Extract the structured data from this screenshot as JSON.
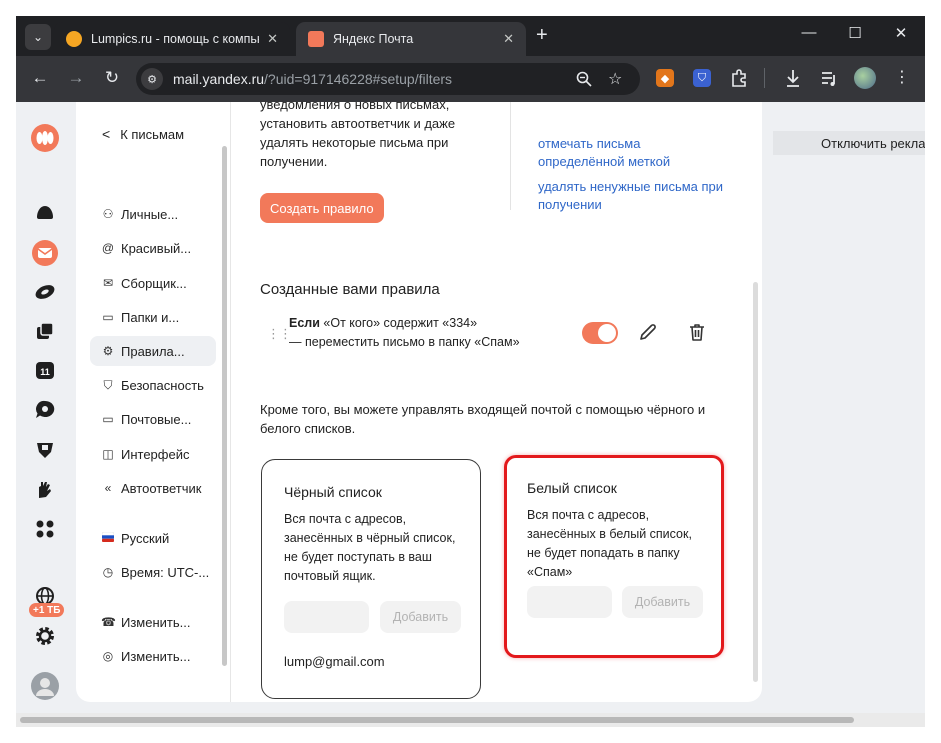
{
  "browser": {
    "tabs": [
      {
        "title": "Lumpics.ru - помощь с компьютером",
        "favicon_color": "#f5a623",
        "active": false
      },
      {
        "title": "Яндекс Почта",
        "favicon_color": "#f2795a",
        "active": true
      }
    ],
    "new_tab_symbol": "+",
    "window_controls": {
      "minimize": "—",
      "maximize": "☐",
      "close": "✕"
    },
    "nav": {
      "back": "←",
      "forward": "→",
      "reload": "↻"
    },
    "url_host": "mail.yandex.ru",
    "url_path": "/?uid=917146228#setup/filters",
    "icons": [
      "zoom-icon",
      "star-icon",
      "fox-extension-icon",
      "shield-extension-icon",
      "puzzle-icon",
      "download-icon",
      "playlist-icon",
      "profile-avatar",
      "menu-icon"
    ]
  },
  "settings_nav": {
    "back_label": "К письмам",
    "items": [
      {
        "label": "Личные...",
        "icon": "person"
      },
      {
        "label": "Красивый...",
        "icon": "at"
      },
      {
        "label": "Сборщик...",
        "icon": "envelope"
      },
      {
        "label": "Папки и...",
        "icon": "folder"
      },
      {
        "label": "Правила...",
        "icon": "rules",
        "active": true
      },
      {
        "label": "Безопасность",
        "icon": "shield"
      },
      {
        "label": "Почтовые...",
        "icon": "laptop"
      },
      {
        "label": "Интерфейс",
        "icon": "layout"
      },
      {
        "label": "Автоответчик",
        "icon": "reply"
      },
      {
        "label": "Русский",
        "icon": "ru-flag"
      },
      {
        "label": "Время: UTC-...",
        "icon": "clock"
      },
      {
        "label": "Изменить...",
        "icon": "phone"
      },
      {
        "label": "Изменить...",
        "icon": "id"
      }
    ]
  },
  "rail": {
    "storage_badge": "+1 ТБ"
  },
  "content": {
    "intro_lines": [
      "уведомления о новых письмах,",
      "установить автоответчик и даже",
      "удалять некоторые письма при",
      "получении."
    ],
    "side_links": [
      {
        "line1": "отмечать письма",
        "line2": "определённой меткой"
      },
      {
        "line1": "удалять ненужные письма при",
        "line2": "получении"
      }
    ],
    "create_rule_button": "Создать правило",
    "rules_title": "Созданные вами правила",
    "rule": {
      "if_word": "Если",
      "condition": " «От кого» содержит «334»",
      "action": "— переместить письмо в папку «Спам»",
      "enabled": true
    },
    "lists_intro_line1": "Кроме того, вы можете управлять входящей почтой с помощью чёрного и",
    "lists_intro_line2": "белого списков.",
    "blacklist": {
      "title": "Чёрный список",
      "desc_lines": [
        "Вся почта с адресов,",
        "занесённых в чёрный список,",
        "не будет поступать в ваш",
        "почтовый ящик."
      ],
      "input_value": "",
      "add_button": "Добавить",
      "entries": [
        "lump@gmail.com"
      ]
    },
    "whitelist": {
      "title": "Белый список",
      "desc_lines": [
        "Вся почта с адресов,",
        "занесённых в белый список,",
        "не будет попадать в папку",
        "«Спам»"
      ],
      "input_value": "",
      "add_button": "Добавить",
      "highlight_color": "#e3191c"
    }
  },
  "ad": {
    "disable_ads": "Отключить рекла"
  },
  "colors": {
    "accent": "#f2795a",
    "link": "#2f67c8"
  }
}
